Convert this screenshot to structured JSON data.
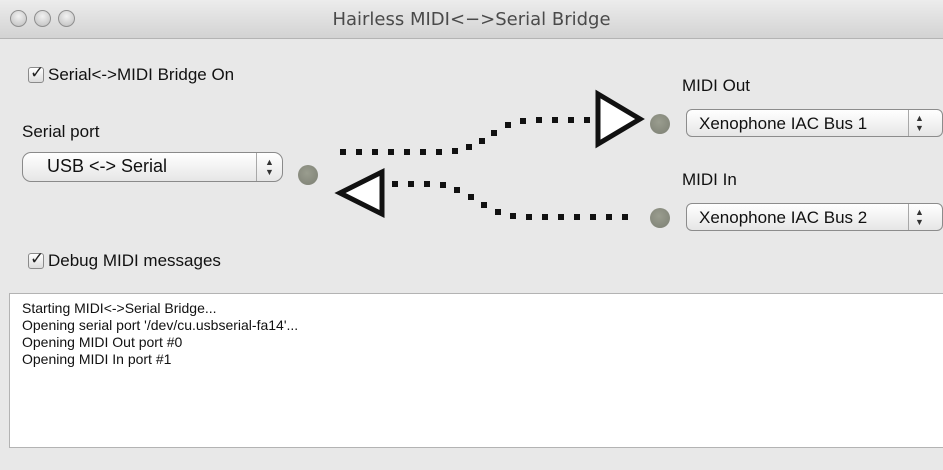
{
  "window": {
    "title": "Hairless MIDI<−>Serial Bridge"
  },
  "bridge": {
    "label": "Serial<->MIDI Bridge On",
    "checked": true
  },
  "serial": {
    "label": "Serial port",
    "selected": "USB <-> Serial"
  },
  "midi_out": {
    "label": "MIDI Out",
    "selected": "Xenophone IAC Bus 1"
  },
  "midi_in": {
    "label": "MIDI In",
    "selected": "Xenophone IAC Bus 2"
  },
  "debug": {
    "label": "Debug MIDI messages",
    "checked": true
  },
  "log": {
    "lines": [
      "Starting MIDI<->Serial Bridge...",
      "Opening serial port '/dev/cu.usbserial-fa14'...",
      "Opening MIDI Out port #0",
      "Opening MIDI In port #1"
    ]
  },
  "icons": [
    "close-icon",
    "minimize-icon",
    "zoom-icon",
    "checkmark-icon",
    "stepper-arrows-icon",
    "activity-led-icon",
    "arrow-right-icon",
    "arrow-left-icon"
  ],
  "colors": {
    "led": "#8b8e82",
    "dots": "#111111",
    "window_bg": "#e8e8e8"
  }
}
